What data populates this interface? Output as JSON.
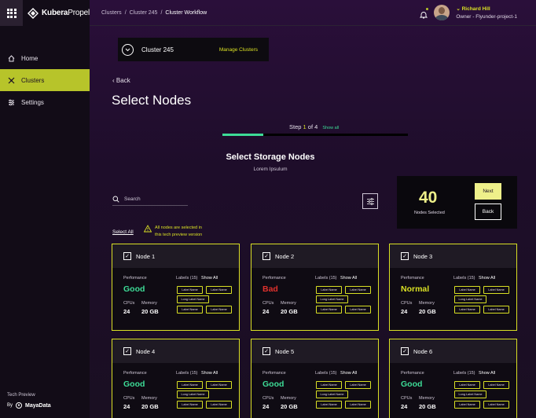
{
  "brand": {
    "name_bold": "Kubera",
    "name_light": "Propel"
  },
  "sidebar": {
    "items": [
      {
        "label": "Home",
        "icon": "home-icon"
      },
      {
        "label": "Clusters",
        "icon": "clusters-icon",
        "active": true
      },
      {
        "label": "Settings",
        "icon": "settings-icon"
      }
    ],
    "tech_preview": "Tech Preview",
    "by": "By",
    "vendor": "MayaData"
  },
  "breadcrumb": {
    "c1": "Clusters",
    "sep": "/",
    "c2": "Cluster 245",
    "c3": "Cluster Workflow"
  },
  "user": {
    "name": "Richard Hill",
    "role": "Owner - Flyunder-project-1"
  },
  "cluster_bar": {
    "name": "Cluster 245",
    "manage": "Manage Clusters"
  },
  "page": {
    "back": "Back",
    "title": "Select Nodes",
    "step_prefix": "Step ",
    "step_current": "1",
    "step_suffix": " of 4",
    "step_show_all": "Show all",
    "progress": 0.22,
    "section_title": "Select Storage Nodes",
    "section_sub": "Lorem Ipsulum",
    "search_placeholder": "Search",
    "select_all": "Select All",
    "notice": "All nodes are selected in this tech preview version"
  },
  "summary": {
    "count": "40",
    "label": "Nodes Selected",
    "next": "Next",
    "back": "Back"
  },
  "colors": {
    "accent": "#d9e024",
    "good": "#3ddc97",
    "bad": "#e0312d",
    "normal": "#d9e024"
  },
  "card_labels": {
    "performance": "Perfomance",
    "labels": "Labels (15)",
    "show_all": "Show All",
    "cpus": "CPUs",
    "memory": "Memory",
    "label_name": "Label Name",
    "long_label_name": "Long Label Name"
  },
  "nodes": [
    {
      "name": "Node 1",
      "performance": "Good",
      "perf_color": "#3ddc97",
      "cpus": "24",
      "memory": "20 GB"
    },
    {
      "name": "Node 2",
      "performance": "Bad",
      "perf_color": "#e0312d",
      "cpus": "24",
      "memory": "20 GB"
    },
    {
      "name": "Node 3",
      "performance": "Normal",
      "perf_color": "#d9e024",
      "cpus": "24",
      "memory": "20 GB"
    },
    {
      "name": "Node 4",
      "performance": "Good",
      "perf_color": "#3ddc97",
      "cpus": "24",
      "memory": "20 GB"
    },
    {
      "name": "Node 5",
      "performance": "Good",
      "perf_color": "#3ddc97",
      "cpus": "24",
      "memory": "20 GB"
    },
    {
      "name": "Node 6",
      "performance": "Good",
      "perf_color": "#3ddc97",
      "cpus": "24",
      "memory": "20 GB"
    }
  ]
}
